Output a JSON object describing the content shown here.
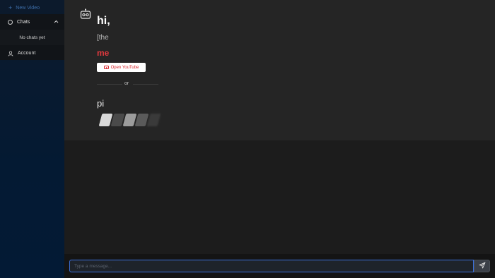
{
  "sidebar": {
    "new_video": {
      "label": "New Video",
      "icon": "plus-icon"
    },
    "chats": {
      "label": "Chats",
      "icon": "chat-bubble-icon",
      "expanded": true,
      "empty_text": "No chats yet"
    },
    "account": {
      "label": "Account",
      "icon": "user-icon"
    }
  },
  "main": {
    "greeting": "hi,",
    "line2": "[the",
    "line3": "me",
    "youtube_button": {
      "label": "Open YouTube",
      "icon": "youtube-icon"
    },
    "or_text": "or",
    "line4": "pi"
  },
  "composer": {
    "placeholder": "Type a message...",
    "send_icon": "send-icon"
  },
  "colors": {
    "accent_blue": "#3b6fd8",
    "youtube_red": "#d8232a",
    "highlight_red": "#e0393e"
  }
}
